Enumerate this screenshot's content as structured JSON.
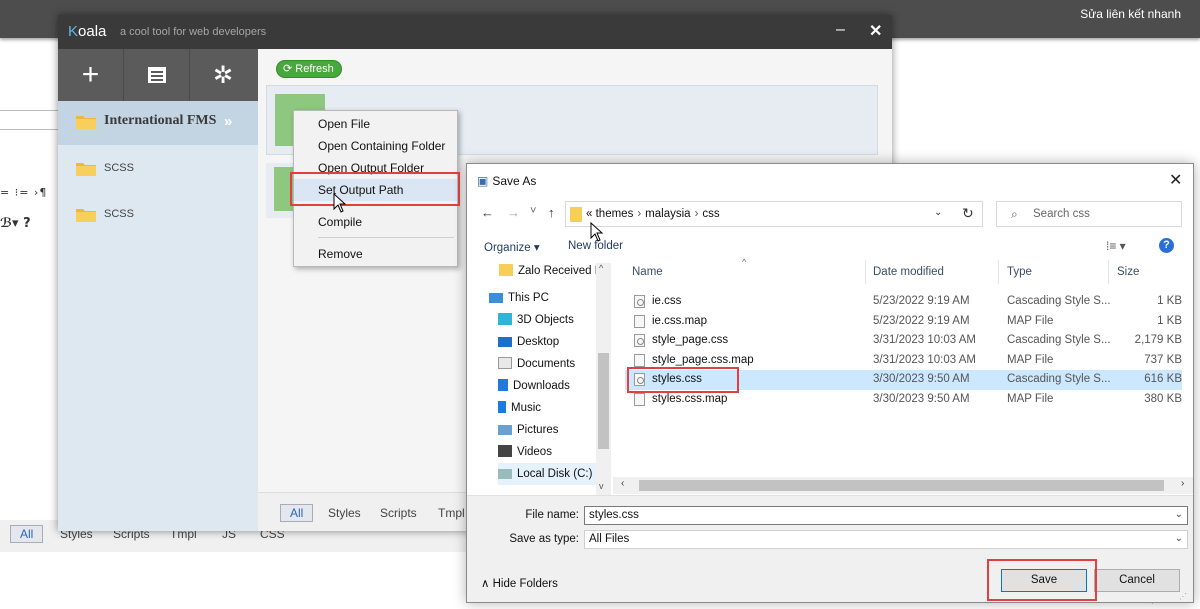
{
  "background": {
    "quick_link": "Sửa liên kết nhanh",
    "toolbar1": "= ⁝= ›¶",
    "toolbar2": "ℬ▾ ?",
    "tabs": [
      "All",
      "Styles",
      "Scripts",
      "Tmpl",
      "JS",
      "CSS"
    ],
    "tail": "▾"
  },
  "koala": {
    "logo_k": "K",
    "logo_rest": "oala",
    "subtitle": "a cool tool for web developers",
    "minimize": "–",
    "close": "✕",
    "tools": {
      "add": "+",
      "doc": "▤",
      "settings": "✲"
    },
    "sidebar": [
      {
        "label": "International FMS",
        "chevron": "»",
        "active": true
      },
      {
        "label": "SCSS",
        "active": false
      },
      {
        "label": "SCSS",
        "active": false
      }
    ],
    "refresh_label": "Refresh",
    "bottom_tabs": [
      "All",
      "Styles",
      "Scripts",
      "Tmpl"
    ]
  },
  "context_menu": {
    "items": [
      "Open File",
      "Open Containing Folder",
      "Open Output Folder",
      "Set Output Path",
      "Compile",
      "Remove"
    ],
    "highlighted": "Set Output Path"
  },
  "dialog": {
    "title": "Save As",
    "close": "✕",
    "nav": {
      "back": "←",
      "forward": "→",
      "recent": "˅",
      "up": "↑"
    },
    "address": {
      "prefix": "«",
      "crumbs": [
        "themes",
        "malaysia",
        "css"
      ],
      "dropdown": "⌄",
      "refresh": "↻"
    },
    "search_placeholder": "Search css",
    "organize": "Organize ▾",
    "new_folder": "New folder",
    "help": "?",
    "tree": [
      {
        "label": "Zalo Received Fi",
        "icon": "folder-icon"
      },
      {
        "label": "This PC",
        "icon": "pc-icon"
      },
      {
        "label": "3D Objects",
        "icon": "cube-icon"
      },
      {
        "label": "Desktop",
        "icon": "desktop-icon"
      },
      {
        "label": "Documents",
        "icon": "documents-icon"
      },
      {
        "label": "Downloads",
        "icon": "download-icon"
      },
      {
        "label": "Music",
        "icon": "music-icon"
      },
      {
        "label": "Pictures",
        "icon": "pictures-icon"
      },
      {
        "label": "Videos",
        "icon": "videos-icon"
      },
      {
        "label": "Local Disk (C:)",
        "icon": "disk-icon"
      }
    ],
    "columns": [
      "Name",
      "Date modified",
      "Type",
      "Size"
    ],
    "files": [
      {
        "name": "ie.css",
        "date": "5/23/2022 9:19 AM",
        "type": "Cascading Style S...",
        "size": "1 KB",
        "css": true
      },
      {
        "name": "ie.css.map",
        "date": "5/23/2022 9:19 AM",
        "type": "MAP File",
        "size": "1 KB",
        "css": false
      },
      {
        "name": "style_page.css",
        "date": "3/31/2023 10:03 AM",
        "type": "Cascading Style S...",
        "size": "2,179 KB",
        "css": true
      },
      {
        "name": "style_page.css.map",
        "date": "3/31/2023 10:03 AM",
        "type": "MAP File",
        "size": "737 KB",
        "css": false
      },
      {
        "name": "styles.css",
        "date": "3/30/2023 9:50 AM",
        "type": "Cascading Style S...",
        "size": "616 KB",
        "css": true,
        "selected": true
      },
      {
        "name": "styles.css.map",
        "date": "3/30/2023 9:50 AM",
        "type": "MAP File",
        "size": "380 KB",
        "css": false
      }
    ],
    "file_name_label": "File name:",
    "file_name_value": "styles.css",
    "save_type_label": "Save as type:",
    "save_type_value": "All Files",
    "hide_folders": "Hide Folders",
    "save_label": "Save",
    "cancel_label": "Cancel"
  },
  "colors": {
    "highlight_box": "#e04040",
    "selected_row": "#cce8ff",
    "koala_sidebar": "#dde8f0",
    "refresh_green": "#49a83d"
  }
}
